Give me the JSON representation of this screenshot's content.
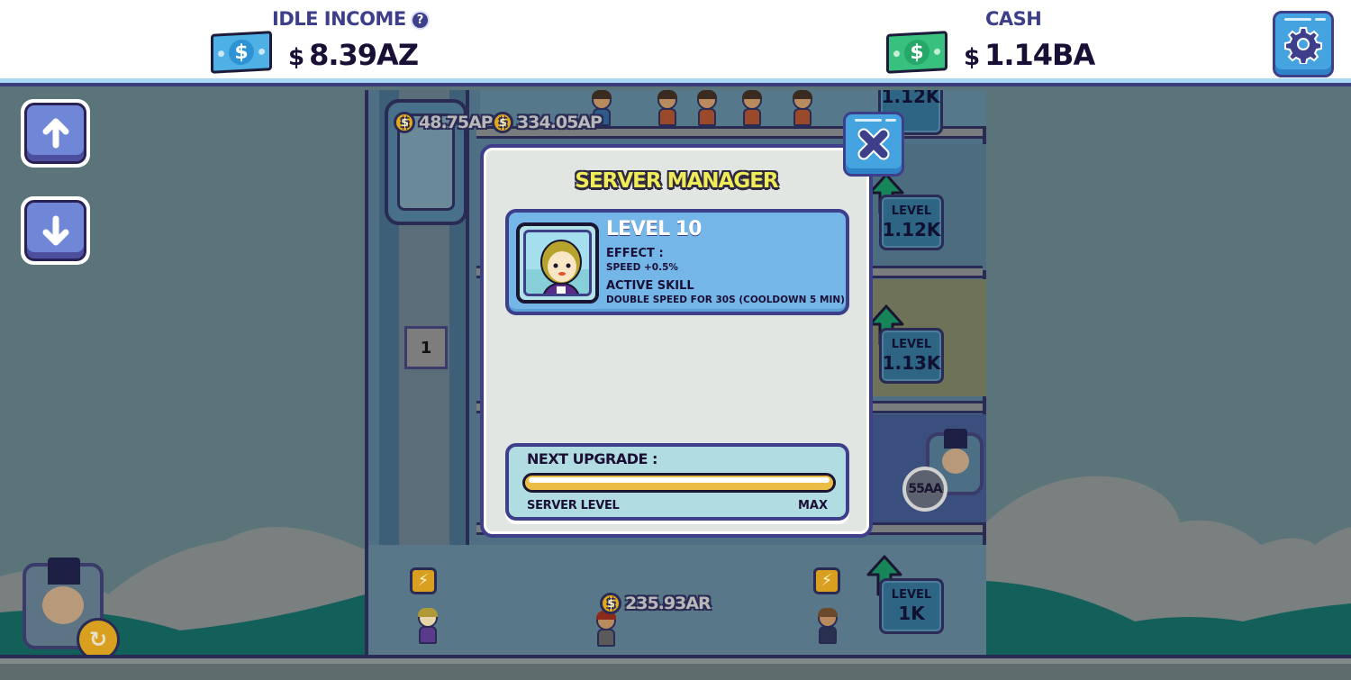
{
  "hud": {
    "idle_income": {
      "label": "IDLE INCOME",
      "currency_symbol": "$",
      "value": "8.39AZ",
      "icon": "banknote-blue-icon",
      "help_icon": "question-mark-icon",
      "help_glyph": "?"
    },
    "cash": {
      "label": "CASH",
      "currency_symbol": "$",
      "value": "1.14BA",
      "icon": "banknote-green-icon"
    },
    "settings": {
      "icon": "gear-icon"
    },
    "bill_glyph": "$"
  },
  "controls": {
    "scroll_up": {
      "icon": "arrow-up-icon"
    },
    "scroll_down": {
      "icon": "arrow-down-icon"
    }
  },
  "scene": {
    "elevator_floor": "1",
    "coin_glyph": "$",
    "coin_readouts": [
      {
        "value": "48.75AP"
      },
      {
        "value": "334.05AP"
      },
      {
        "value": "235.93AR"
      }
    ],
    "floor_levels": [
      {
        "label": "",
        "value": "1.12K"
      },
      {
        "label": "LEVEL",
        "value": "1.12K"
      },
      {
        "label": "LEVEL",
        "value": "1.13K"
      },
      {
        "label": "LEVEL",
        "value": "1K"
      }
    ],
    "boss_badge": "55AA",
    "boss_refresh_icon": "refresh-icon",
    "lightning_icon": "lightning-icon"
  },
  "modal": {
    "title": "SERVER MANAGER",
    "close_icon": "close-x-icon",
    "manager": {
      "level": "LEVEL 10",
      "effect_label": "EFFECT :",
      "effect_value": "SPEED +0.5%",
      "skill_label": "ACTIVE SKILL",
      "skill_value": "DOUBLE SPEED FOR 30S (COOLDOWN 5 MIN)"
    },
    "upgrade": {
      "label": "NEXT UPGRADE :",
      "progress_percent": 100,
      "left_caption": "SERVER LEVEL",
      "right_caption": "MAX"
    }
  },
  "colors": {
    "hud_text": "#3e3f8a",
    "value_text": "#1a0f35",
    "title_yellow": "#f0ec58",
    "button_blue": "#45a3e0",
    "progress_yellow": "#ecbd45",
    "card_blue": "#75b6e9",
    "nav_button": "#6f87d6"
  }
}
